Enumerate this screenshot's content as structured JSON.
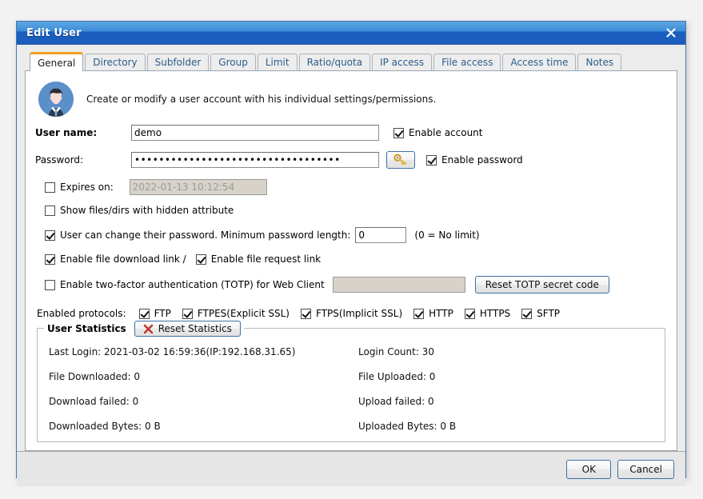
{
  "window": {
    "title": "Edit User",
    "close_icon": "close-icon"
  },
  "tabs": [
    {
      "label": "General",
      "active": true
    },
    {
      "label": "Directory",
      "active": false
    },
    {
      "label": "Subfolder",
      "active": false
    },
    {
      "label": "Group",
      "active": false
    },
    {
      "label": "Limit",
      "active": false
    },
    {
      "label": "Ratio/quota",
      "active": false
    },
    {
      "label": "IP access",
      "active": false
    },
    {
      "label": "File access",
      "active": false
    },
    {
      "label": "Access time",
      "active": false
    },
    {
      "label": "Notes",
      "active": false
    }
  ],
  "header": {
    "avatar_icon": "user-avatar-icon",
    "description": "Create or modify a user account with his individual settings/permissions."
  },
  "form": {
    "username_label": "User name:",
    "username_value": "demo",
    "enable_account_label": "Enable account",
    "enable_account_checked": true,
    "password_label": "Password:",
    "password_value": "••••••••••••••••••••••••••••••••••",
    "password_key_icon": "key-icon",
    "enable_password_label": "Enable password",
    "enable_password_checked": true,
    "expires_label": "Expires on:",
    "expires_checked": false,
    "expires_value": "2022-01-13 10:12:54",
    "hidden_attr_label": "Show files/dirs with hidden attribute",
    "hidden_attr_checked": false,
    "change_password_label": "User can change their password. Minimum password length:",
    "change_password_checked": true,
    "min_password_length": "0",
    "no_limit_hint": "(0 = No limit)",
    "download_link_label": "Enable file download link /",
    "download_link_checked": true,
    "request_link_label": "Enable file request link",
    "request_link_checked": true,
    "totp_label": "Enable two-factor authentication (TOTP) for Web Client",
    "totp_checked": false,
    "totp_value": "",
    "reset_totp_button": "Reset TOTP secret code"
  },
  "protocols": {
    "label": "Enabled protocols:",
    "items": [
      {
        "label": "FTP",
        "checked": true
      },
      {
        "label": "FTPES(Explicit SSL)",
        "checked": true
      },
      {
        "label": "FTPS(Implicit SSL)",
        "checked": true
      },
      {
        "label": "HTTP",
        "checked": true
      },
      {
        "label": "HTTPS",
        "checked": true
      },
      {
        "label": "SFTP",
        "checked": true
      }
    ]
  },
  "statistics": {
    "title": "User Statistics",
    "reset_button": "Reset Statistics",
    "reset_icon": "red-x-icon",
    "left": [
      "Last Login: 2021-03-02 16:59:36(IP:192.168.31.65)",
      "File Downloaded: 0",
      "Download failed: 0",
      "Downloaded Bytes: 0 B"
    ],
    "right": [
      "Login Count: 30",
      "File Uploaded: 0",
      "Upload failed: 0",
      "Uploaded Bytes: 0 B"
    ]
  },
  "footer": {
    "ok_label": "OK",
    "cancel_label": "Cancel"
  },
  "colors": {
    "titlebar_blue": "#1c5dbb",
    "active_tab_accent": "#f0a020",
    "avatar_blue": "#5b8fc9",
    "reset_icon_red": "#c0392b"
  }
}
